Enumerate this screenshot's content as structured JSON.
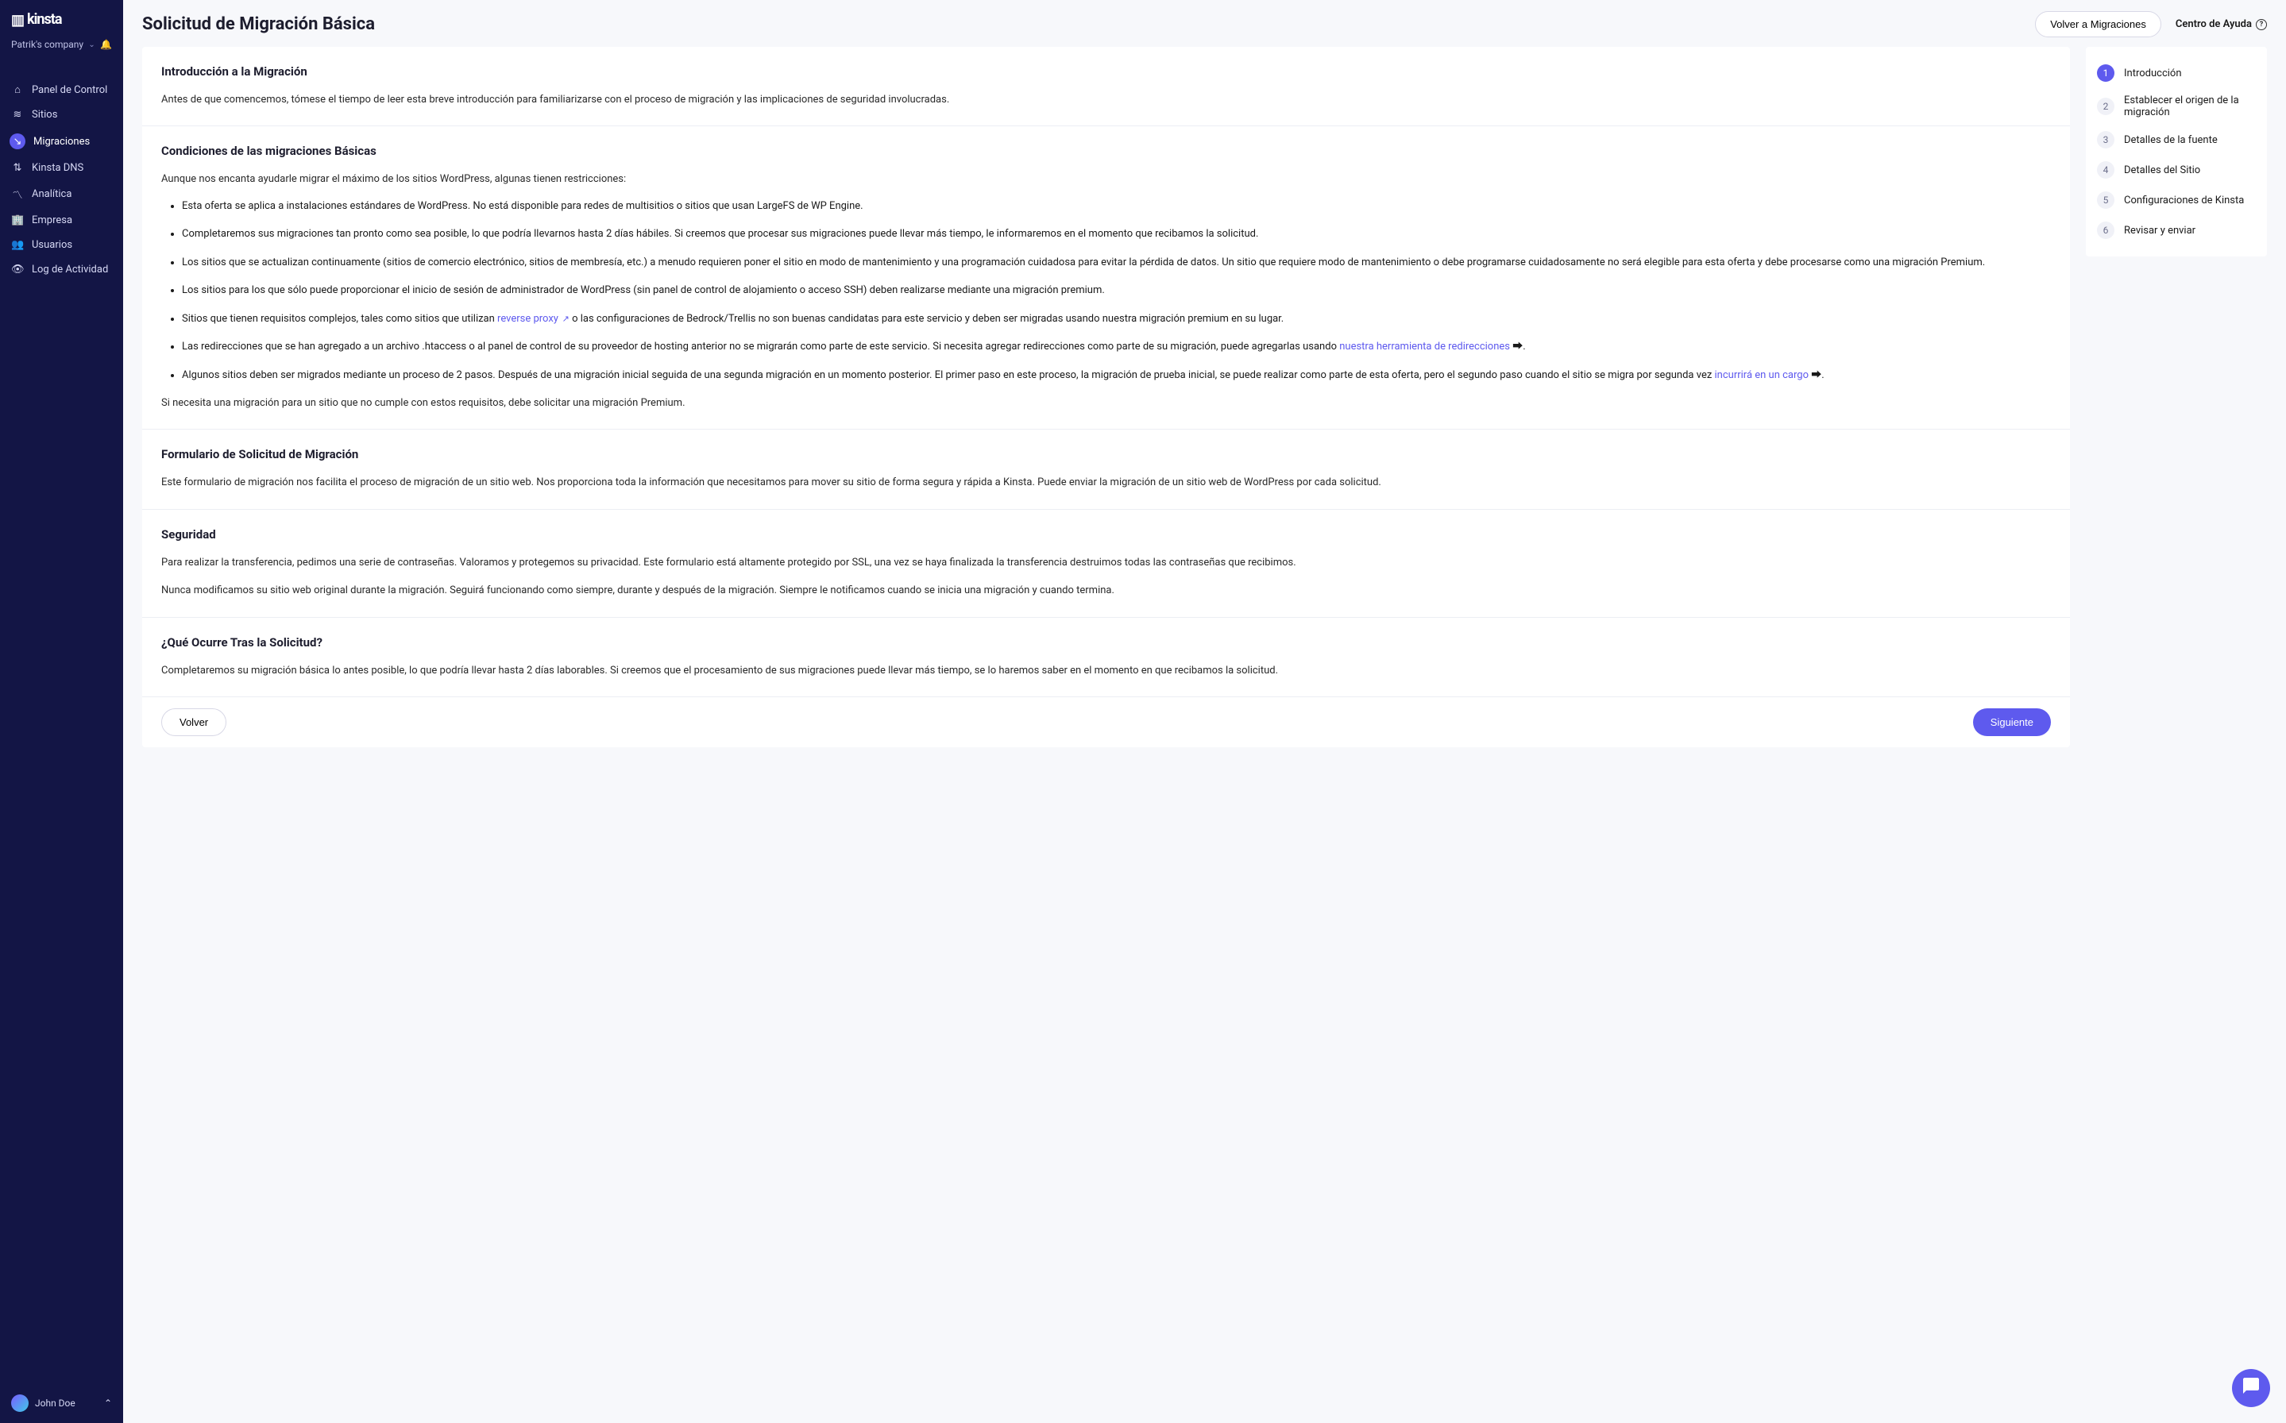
{
  "brand": "kinsta",
  "company_name": "Patrik's company",
  "sidebar": {
    "items": [
      {
        "icon": "⌂",
        "label": "Panel de Control"
      },
      {
        "icon": "≋",
        "label": "Sitios"
      },
      {
        "icon": "↘",
        "label": "Migraciones"
      },
      {
        "icon": "⇅",
        "label": "Kinsta DNS"
      },
      {
        "icon": "〽",
        "label": "Analítica"
      },
      {
        "icon": "🏢",
        "label": "Empresa"
      },
      {
        "icon": "👥",
        "label": "Usuarios"
      },
      {
        "icon": "👁",
        "label": "Log de Actividad"
      }
    ]
  },
  "user_name": "John Doe",
  "header": {
    "title": "Solicitud de Migración Básica",
    "back_button": "Volver a Migraciones",
    "help_label": "Centro de Ayuda"
  },
  "steps": [
    "Introducción",
    "Establecer el origen de la migración",
    "Detalles de la fuente",
    "Detalles del Sitio",
    "Configuraciones de Kinsta",
    "Revisar y enviar"
  ],
  "sections": {
    "intro": {
      "title": "Introducción a la Migración",
      "text": "Antes de que comencemos, tómese el tiempo de leer esta breve introducción para familiarizarse con el proceso de migración y las implicaciones de seguridad involucradas."
    },
    "conditions": {
      "title": "Condiciones de las migraciones Básicas",
      "intro": "Aunque nos encanta ayudarle migrar el máximo de los sitios WordPress, algunas tienen restricciones:",
      "items": [
        "Esta oferta se aplica a instalaciones estándares de WordPress. No está disponible para redes de multisitios o sitios que usan LargeFS de WP Engine.",
        "Completaremos sus migraciones tan pronto como sea posible, lo que podría llevarnos hasta 2 días hábiles. Si creemos que procesar sus migraciones puede llevar más tiempo, le informaremos en el momento que recibamos la solicitud.",
        "Los sitios que se actualizan continuamente (sitios de comercio electrónico, sitios de membresía, etc.) a menudo requieren poner el sitio en modo de mantenimiento y una programación cuidadosa para evitar la pérdida de datos. Un sitio que requiere modo de mantenimiento o debe programarse cuidadosamente no será elegible para esta oferta y debe procesarse como una migración Premium.",
        "Los sitios para los que sólo puede proporcionar el inicio de sesión de administrador de WordPress (sin panel de control de alojamiento o acceso SSH) deben realizarse mediante una migración premium."
      ],
      "item5_a": "Sitios que tienen requisitos complejos, tales como sitios que utilizan ",
      "item5_link": "reverse proxy",
      "item5_b": " o las configuraciones de Bedrock/Trellis no son buenas candidatas para este servicio y deben ser migradas usando nuestra migración premium en su lugar.",
      "item6_a": "Las redirecciones que se han agregado a un archivo .htaccess o al panel de control de su proveedor de hosting anterior no se migrarán como parte de este servicio. Si necesita agregar redirecciones como parte de su migración, puede agregarlas usando ",
      "item6_link": "nuestra herramienta de redirecciones",
      "item6_b": " ⮕.",
      "item7_a": "Algunos sitios deben ser migrados mediante un proceso de 2 pasos. Después de una migración inicial seguida de una segunda migración en un momento posterior. El primer paso en este proceso, la migración de prueba inicial, se puede realizar como parte de esta oferta, pero el segundo paso cuando el sitio se migra por segunda vez ",
      "item7_link": "incurrirá en un cargo",
      "item7_b": " ⮕.",
      "outro": "Si necesita una migración para un sitio que no cumple con estos requisitos, debe solicitar una migración Premium."
    },
    "form": {
      "title": "Formulario de Solicitud de Migración",
      "text": "Este formulario de migración nos facilita el proceso de migración de un sitio web. Nos proporciona toda la información que necesitamos para mover su sitio de forma segura y rápida a Kinsta. Puede enviar la migración de un sitio web de WordPress por cada solicitud."
    },
    "security": {
      "title": "Seguridad",
      "p1": "Para realizar la transferencia, pedimos una serie de contraseñas. Valoramos y protegemos su privacidad. Este formulario está altamente protegido por SSL, una vez se haya finalizada la transferencia destruimos todas las contraseñas que recibimos.",
      "p2": "Nunca modificamos su sitio web original durante la migración. Seguirá funcionando como siempre, durante y después de la migración. Siempre le notificamos cuando se inicia una migración y cuando termina."
    },
    "after": {
      "title": "¿Qué Ocurre Tras la Solicitud?",
      "text": "Completaremos su migración básica lo antes posible, lo que podría llevar hasta 2 días laborables. Si creemos que el procesamiento de sus migraciones puede llevar más tiempo, se lo haremos saber en el momento en que recibamos la solicitud."
    }
  },
  "footer": {
    "back": "Volver",
    "next": "Siguiente"
  }
}
